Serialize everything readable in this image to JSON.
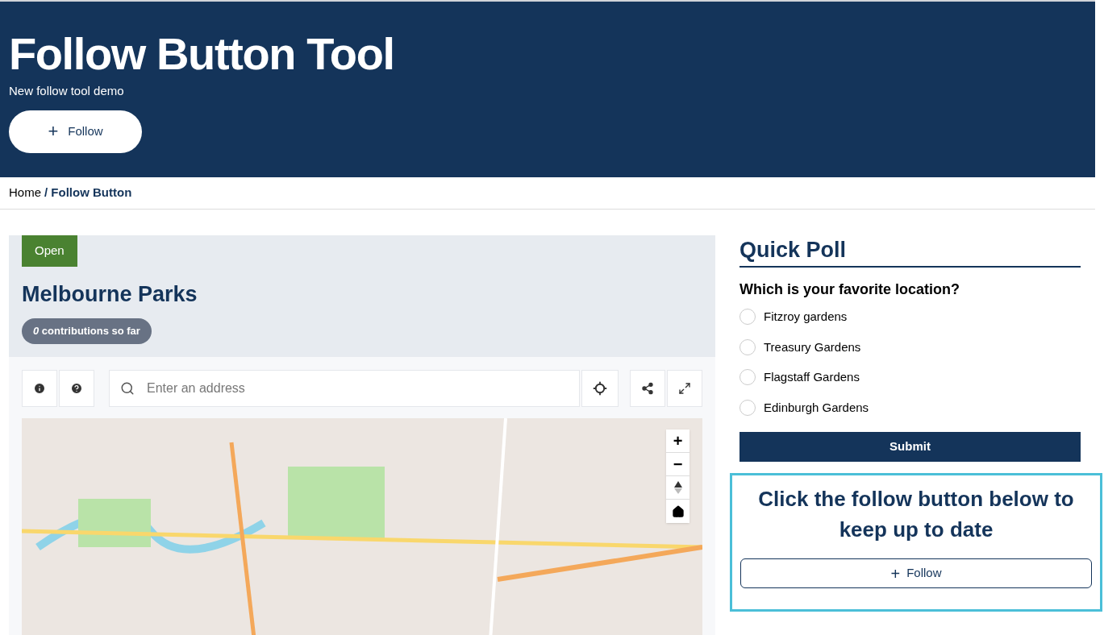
{
  "header": {
    "title": "Follow Button Tool",
    "subtitle": "New follow tool demo",
    "follow_button": {
      "icon": "+",
      "label": "Follow"
    }
  },
  "breadcrumb": [
    {
      "label": "Home",
      "current": false
    },
    {
      "label": "/ Follow Button",
      "current": true
    }
  ],
  "project": {
    "status": "Open",
    "title": "Melbourne Parks",
    "contributions": "*0* contributions so far"
  },
  "map": {
    "search": {
      "placeholder": "Enter an address"
    },
    "zoom_controls": [
      "+",
      "−"
    ]
  },
  "poll": {
    "title": "Quick Poll",
    "question": "Which is your favorite location?",
    "options": [
      {
        "label": "Fitzroy gardens",
        "selected": false
      },
      {
        "label": "Treasury Gardens",
        "selected": false
      },
      {
        "label": "Flagstaff Gardens",
        "selected": false
      },
      {
        "label": "Edinburgh Gardens",
        "selected": false
      }
    ],
    "submit": "Submit"
  },
  "follow_prompt": {
    "text": "Click the follow button below to keep up to date",
    "button": {
      "icon": "+",
      "label": "Follow"
    }
  }
}
